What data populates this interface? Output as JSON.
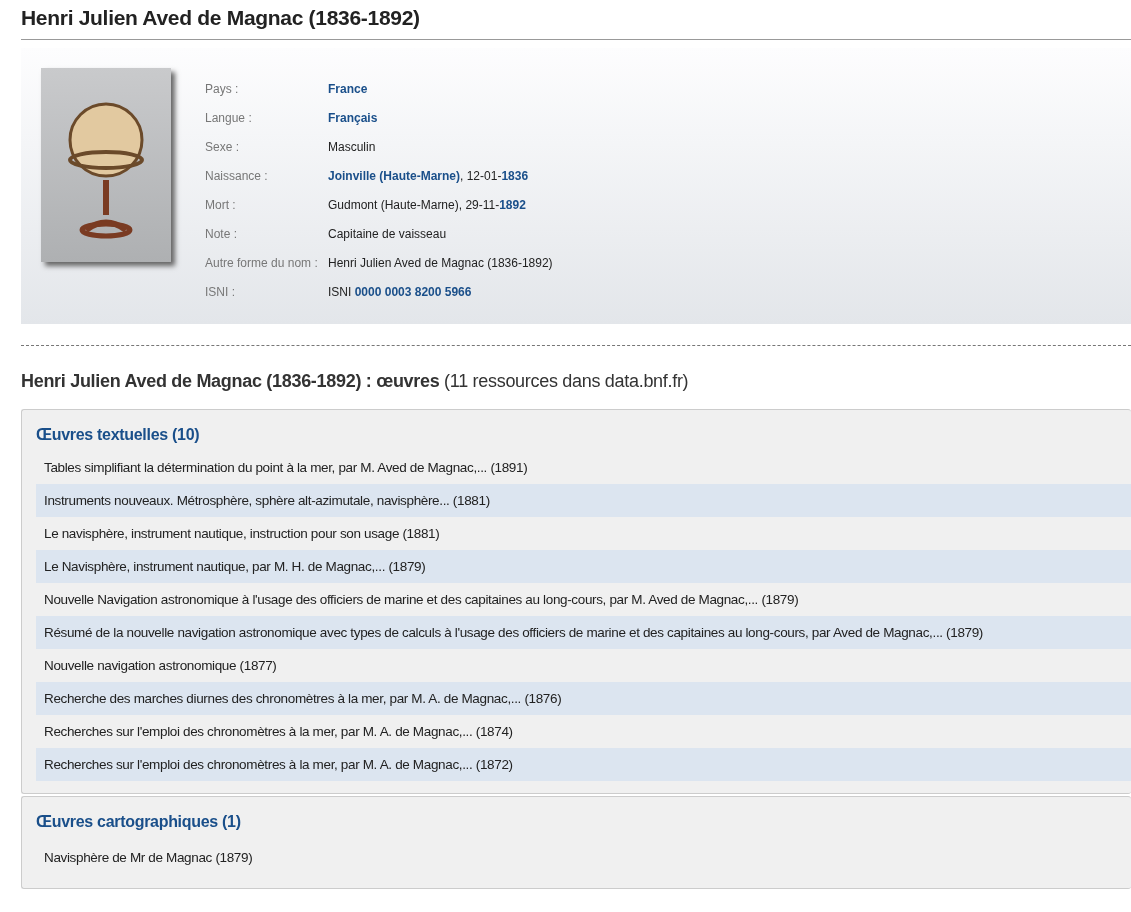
{
  "title": "Henri Julien Aved de Magnac (1836-1892)",
  "profile": {
    "fields": [
      {
        "label": "Pays :",
        "value": [
          {
            "text": "France",
            "link": true
          }
        ]
      },
      {
        "label": "Langue :",
        "value": [
          {
            "text": "Français",
            "link": true
          }
        ]
      },
      {
        "label": "Sexe :",
        "value": [
          {
            "text": "Masculin",
            "link": false
          }
        ]
      },
      {
        "label": "Naissance :",
        "value": [
          {
            "text": "Joinville (Haute-Marne)",
            "link": true
          },
          {
            "text": ", 12-01-",
            "link": false
          },
          {
            "text": "1836",
            "link": true
          }
        ]
      },
      {
        "label": "Mort :",
        "value": [
          {
            "text": "Gudmont (Haute-Marne), 29-11-",
            "link": false
          },
          {
            "text": "1892",
            "link": true
          }
        ]
      },
      {
        "label": "Note :",
        "value": [
          {
            "text": "Capitaine de vaisseau",
            "link": false
          }
        ]
      },
      {
        "label": "Autre forme du nom :",
        "value": [
          {
            "text": "Henri Julien Aved de Magnac (1836-1892)",
            "link": false
          }
        ]
      },
      {
        "label": "ISNI :",
        "value": [
          {
            "text": "ISNI ",
            "link": false
          },
          {
            "text": "0000 0003 8200 5966",
            "link": true
          }
        ]
      }
    ]
  },
  "works_heading": "**Henri Julien Aved de Magnac (1836-1892) : œuvres** (11 ressources dans data.bnf.fr)",
  "sections": [
    {
      "title": "Œuvres textuelles (10)",
      "items": [
        "Tables simplifiant la détermination du point à la mer, par M. Aved de Magnac,... (1891)",
        "Instruments nouveaux. Métrosphère, sphère alt-azimutale, navisphère... (1881)",
        "Le navisphère, instrument nautique, instruction pour son usage (1881)",
        "Le Navisphère, instrument nautique, par M. H. de Magnac,... (1879)",
        "Nouvelle Navigation astronomique à l'usage des officiers de marine et des capitaines au long-cours, par M. Aved de Magnac,... (1879)",
        "Résumé de la nouvelle navigation astronomique avec types de calculs à l'usage des officiers de marine et des capitaines au long-cours, par Aved de Magnac,... (1879)",
        "Nouvelle navigation astronomique (1877)",
        "Recherche des marches diurnes des chronomètres à la mer, par M. A. de Magnac,... (1876)",
        "Recherches sur l'emploi des chronomètres à la mer, par M. A. de Magnac,... (1874)",
        "Recherches sur l'emploi des chronomètres à la mer, par M. A. de Magnac,... (1872)"
      ]
    },
    {
      "title": "Œuvres cartographiques (1)",
      "items": [
        "Navisphère de Mr de Magnac (1879)"
      ]
    }
  ]
}
